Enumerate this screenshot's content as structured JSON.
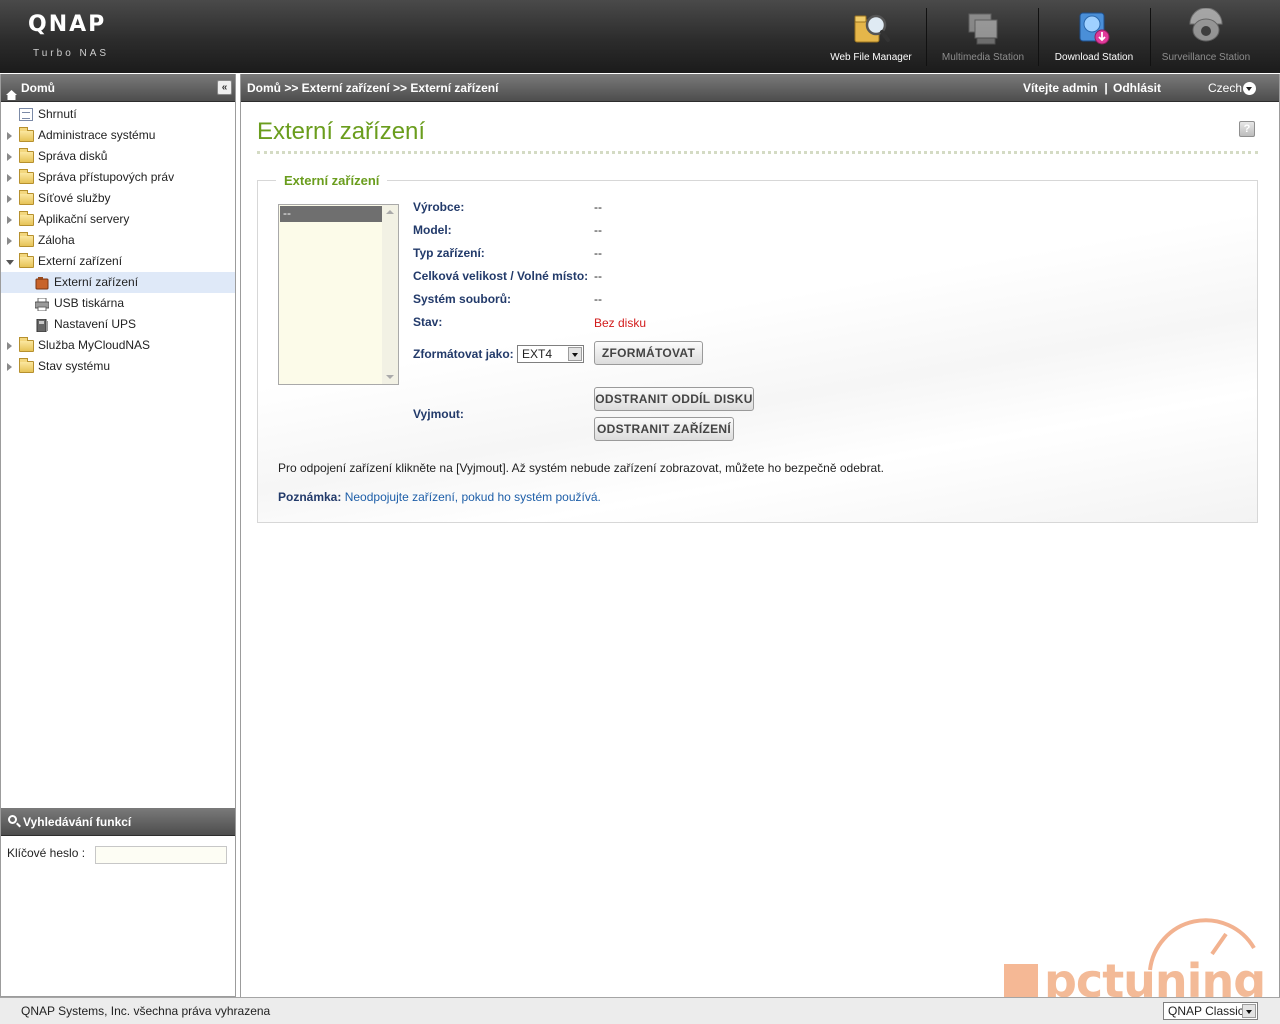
{
  "header": {
    "logo": "QNAP",
    "tagline": "Turbo NAS",
    "apps": [
      {
        "label": "Web File Manager",
        "icon": "web-file-manager-icon",
        "enabled": true
      },
      {
        "label": "Multimedia Station",
        "icon": "multimedia-station-icon",
        "enabled": false
      },
      {
        "label": "Download Station",
        "icon": "download-station-icon",
        "enabled": true
      },
      {
        "label": "Surveillance Station",
        "icon": "surveillance-station-icon",
        "enabled": false
      }
    ]
  },
  "sidebar": {
    "title": "Domů",
    "collapse_symbol": "«",
    "items": [
      {
        "label": "Shrnutí"
      },
      {
        "label": "Administrace systému"
      },
      {
        "label": "Správa disků"
      },
      {
        "label": "Správa přístupových práv"
      },
      {
        "label": "Síťové služby"
      },
      {
        "label": "Aplikační servery"
      },
      {
        "label": "Záloha"
      },
      {
        "label": "Externí zařízení"
      },
      {
        "label": "Služba MyCloudNAS"
      },
      {
        "label": "Stav systému"
      }
    ],
    "children": [
      {
        "label": "Externí zařízení",
        "selected": true
      },
      {
        "label": "USB tiskárna"
      },
      {
        "label": "Nastavení UPS"
      }
    ],
    "search": {
      "title": "Vyhledávání funkcí",
      "keyword_label": "Klíčové heslo :",
      "keyword_value": ""
    }
  },
  "topbar": {
    "breadcrumb": "Domů >> Externí zařízení >> Externí zařízení",
    "welcome": "Vítejte admin",
    "separator": "|",
    "logout": "Odhlásit",
    "language": "Czech"
  },
  "main": {
    "title": "Externí zařízení",
    "help_symbol": "?",
    "fieldset_title": "Externí zařízení",
    "device_list": [
      "--"
    ],
    "properties": {
      "manufacturer_label": "Výrobce:",
      "manufacturer_value": "--",
      "model_label": "Model:",
      "model_value": "--",
      "type_label": "Typ zařízení:",
      "type_value": "--",
      "size_label": "Celková velikost / Volné místo:",
      "size_value": "--",
      "fs_label": "Systém souborů:",
      "fs_value": "--",
      "status_label": "Stav:",
      "status_value": "Bez disku"
    },
    "format_label": "Zformátovat jako:",
    "format_value": "EXT4",
    "format_button": "ZFORMÁTOVAT",
    "eject_label": "Vyjmout:",
    "remove_partition_button": "ODSTRANIT ODDÍL DISKU",
    "remove_device_button": "ODSTRANIT ZAŘÍZENÍ",
    "info_text": "Pro odpojení zařízení klikněte na [Vyjmout]. Až systém nebude zařízení zobrazovat, můžete ho bezpečně odebrat.",
    "note_label": "Poznámka:",
    "note_text": "Neodpojujte zařízení, pokud ho systém používá."
  },
  "footer": {
    "copyright": "QNAP Systems, Inc. všechna práva vyhrazena",
    "skin": "QNAP Classic"
  },
  "watermark": "pctuning",
  "colors": {
    "accent_green": "#6a9d1d",
    "status_red": "#d21b1b",
    "note_blue": "#1d5ea8",
    "header_dark": "#2c2c2c"
  }
}
